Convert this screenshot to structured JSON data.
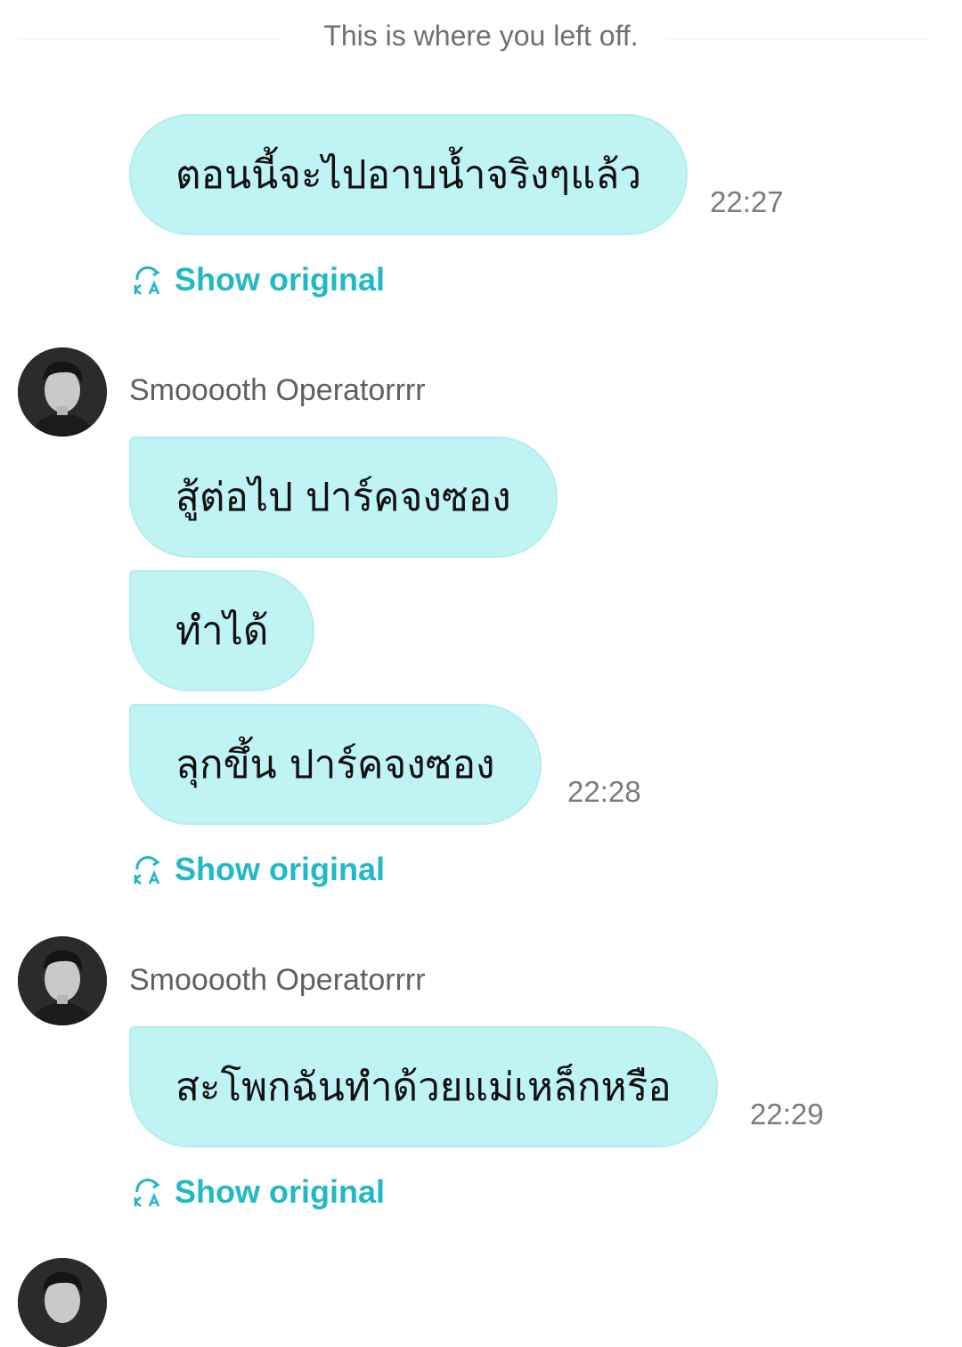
{
  "divider": {
    "text": "This is where you left off."
  },
  "messages": [
    {
      "text": "ตอนนี้จะไปอาบน้ำจริงๆแล้ว",
      "time": "22:27"
    },
    {
      "text": "สู้ต่อไป ปาร์คจงซอง"
    },
    {
      "text": "ทำได้"
    },
    {
      "text": "ลุกขึ้น ปาร์คจงซอง",
      "time": "22:28"
    },
    {
      "text": "สะโพกฉันทำด้วยแม่เหล็กหรือ",
      "time": "22:29"
    }
  ],
  "show_original_label": "Show original",
  "sender_name": "Smooooth Operatorrrr",
  "icons": {
    "translate": "translate-icon",
    "avatar": "avatar-photo"
  },
  "colors": {
    "bubble": "#c0f3f4",
    "accent": "#22b8c6"
  }
}
